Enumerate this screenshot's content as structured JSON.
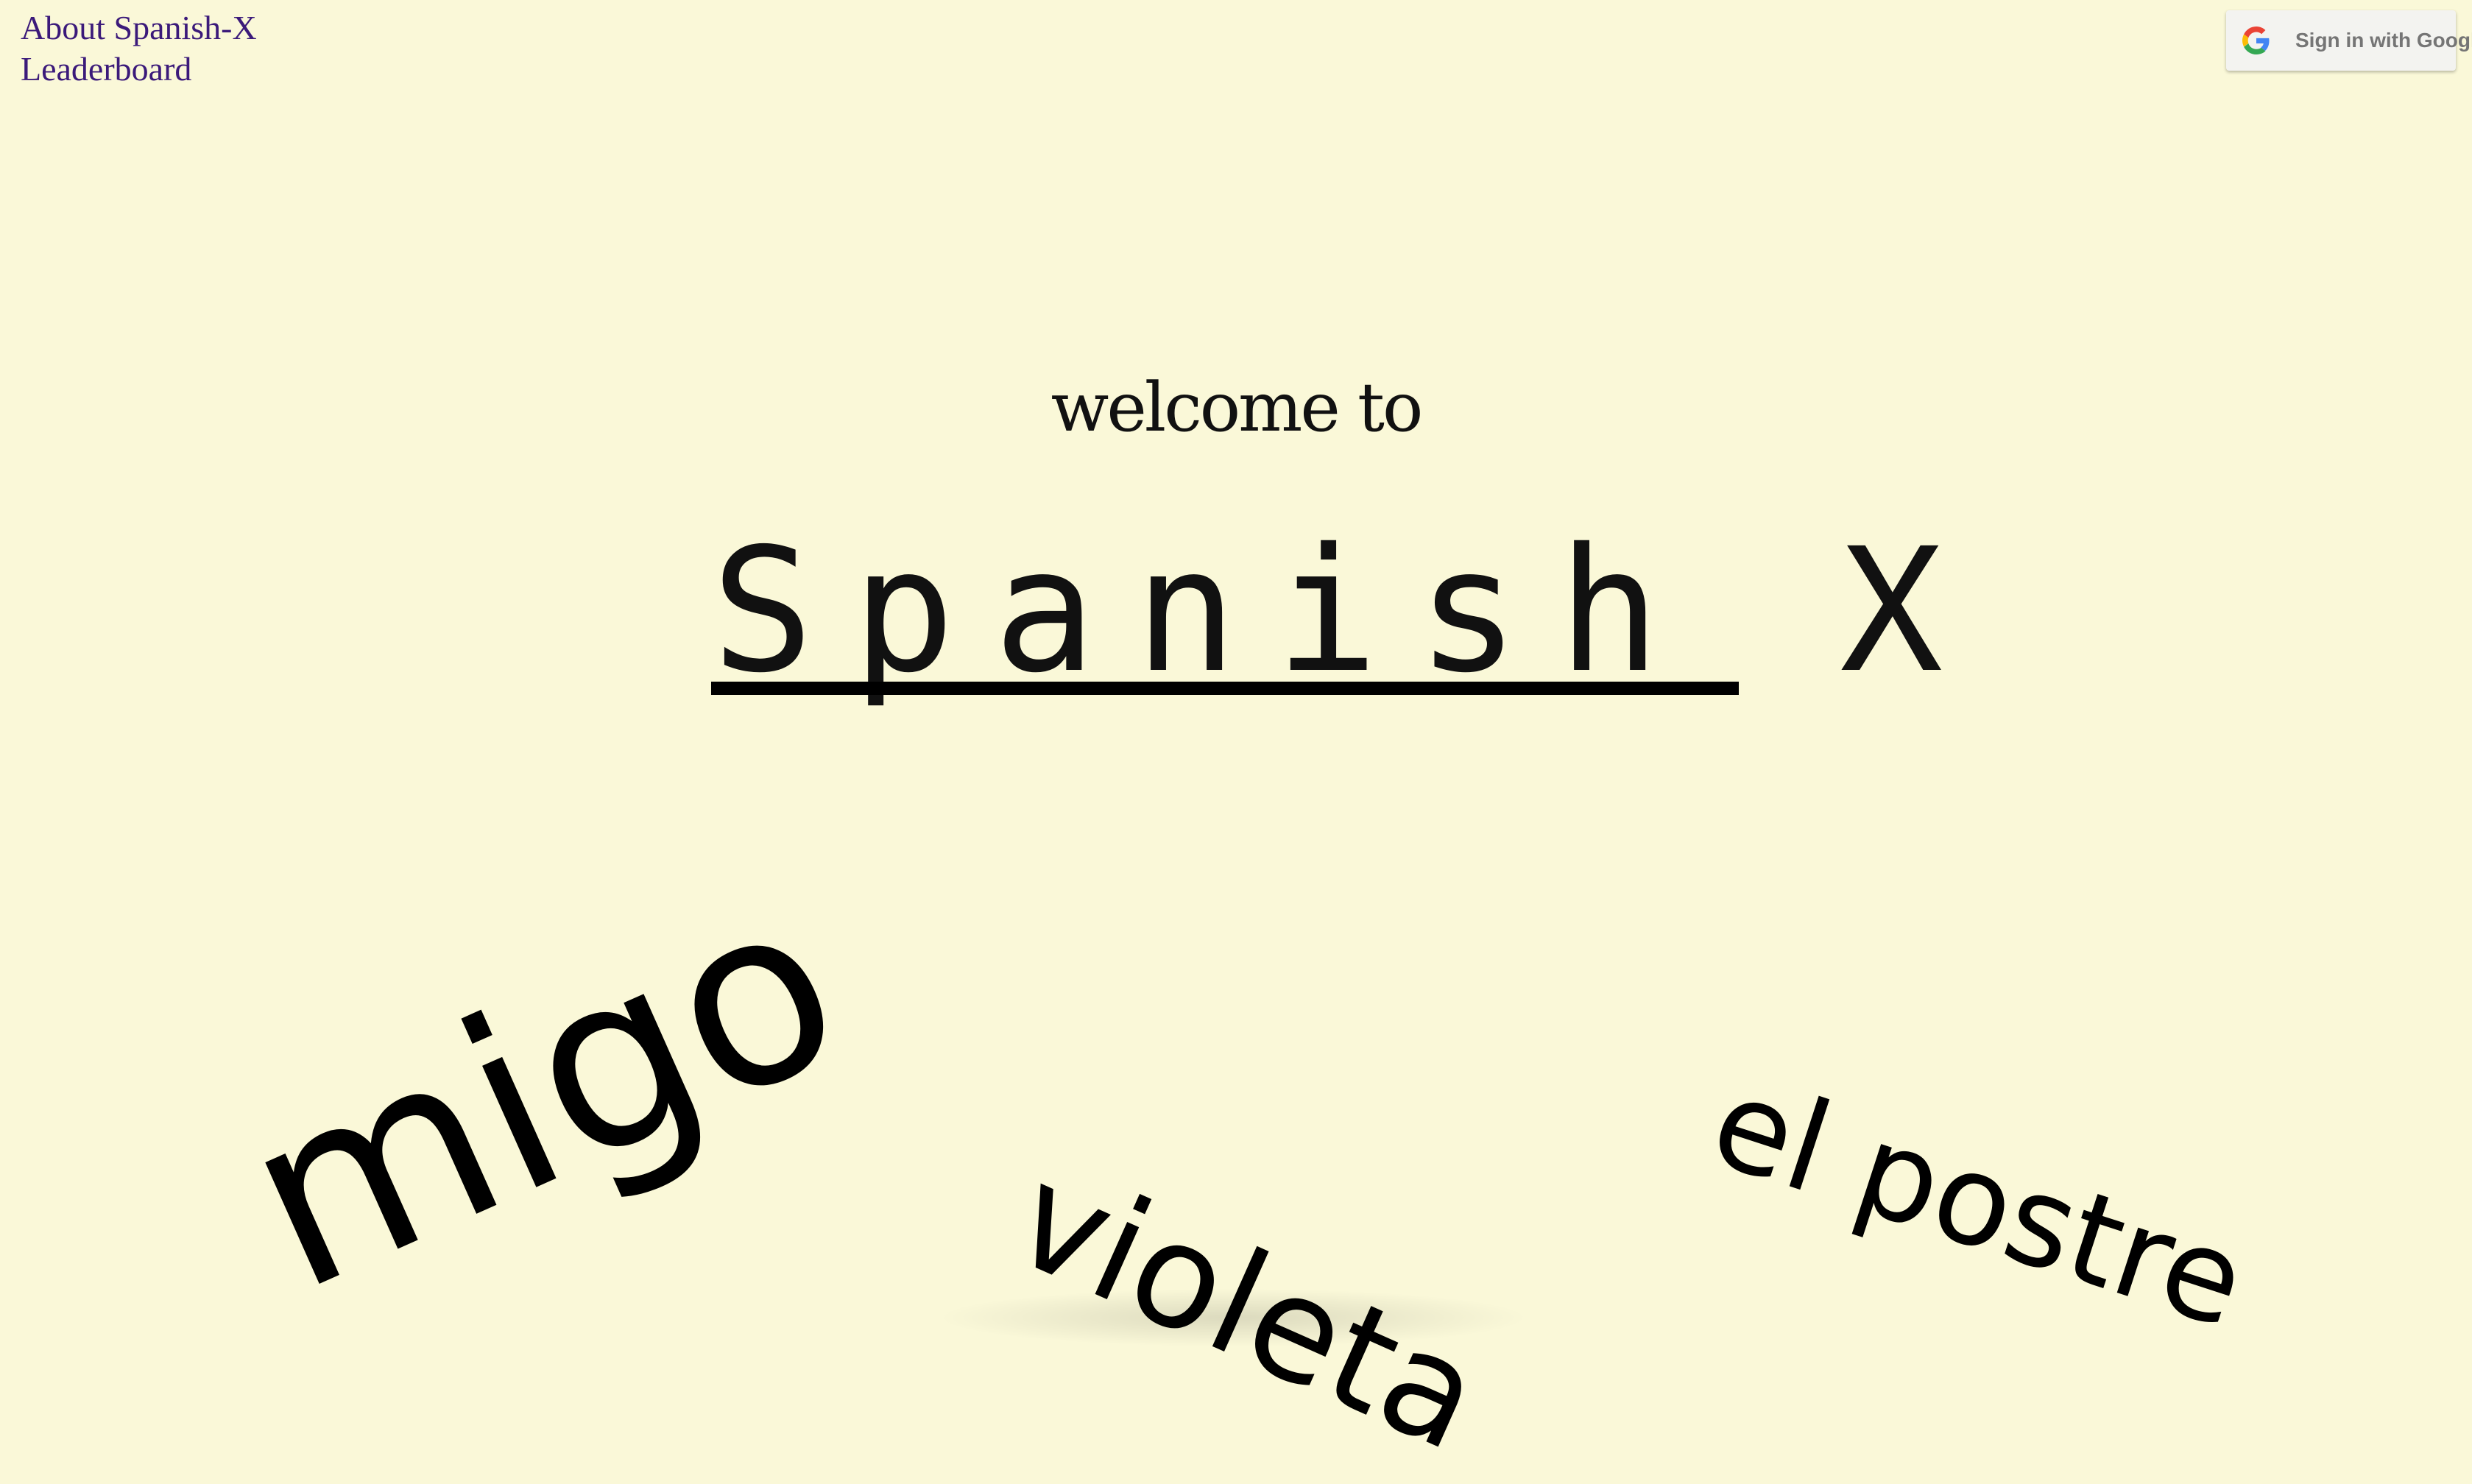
{
  "nav": {
    "about_label": "About Spanish-X",
    "leaderboard_label": "Leaderboard"
  },
  "auth": {
    "signin_label": "Sign in with Google",
    "icon": "google-icon"
  },
  "hero": {
    "welcome": "welcome to",
    "title": "Spanish X"
  },
  "floating_words": [
    {
      "text": "migo"
    },
    {
      "text": "violeta"
    },
    {
      "text": "el postre"
    }
  ],
  "colors": {
    "background": "#faf8d8",
    "link": "#3b1a7a",
    "text": "#111111"
  }
}
